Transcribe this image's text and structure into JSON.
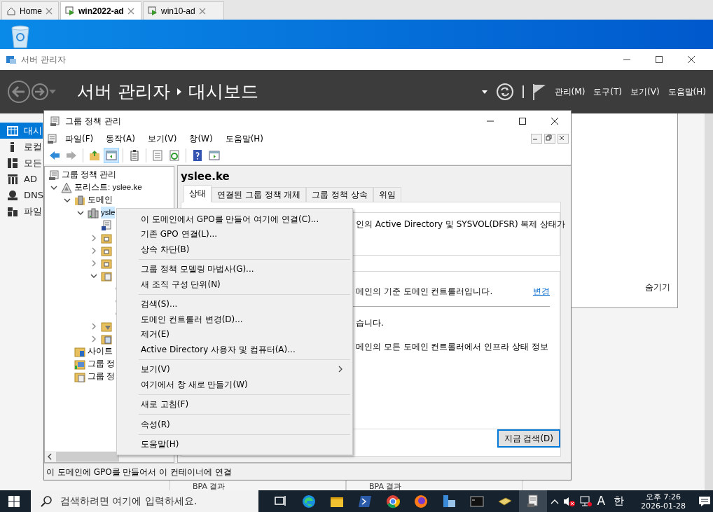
{
  "browser_tabs": [
    {
      "label": "Home",
      "kind": "home",
      "selected": false
    },
    {
      "label": "win2022-ad",
      "kind": "vm",
      "selected": true
    },
    {
      "label": "win10-ad",
      "kind": "vm",
      "selected": false
    }
  ],
  "server_manager": {
    "title": "서버 관리자",
    "breadcrumb": [
      "서버 관리자",
      "대시보드"
    ],
    "menu": [
      "관리(M)",
      "도구(T)",
      "보기(V)",
      "도움말(H)"
    ],
    "sidebar": [
      {
        "label": "대시",
        "kind": "dashboard",
        "selected": true
      },
      {
        "label": "로컬",
        "kind": "local",
        "selected": false
      },
      {
        "label": "모든",
        "kind": "all",
        "selected": false
      },
      {
        "label": "AD",
        "kind": "ad",
        "selected": false
      },
      {
        "label": "DNS",
        "kind": "dns",
        "selected": false
      },
      {
        "label": "파일",
        "kind": "file",
        "selected": false
      }
    ],
    "hide_link": "숨기기",
    "bpa": [
      "BPA 결과",
      "BPA 결과"
    ]
  },
  "gpm": {
    "title": "그룹 정책 관리",
    "menu": [
      "파일(F)",
      "동작(A)",
      "보기(V)",
      "창(W)",
      "도움말(H)"
    ],
    "toolbar": [
      {
        "kind": "back",
        "pressed": false,
        "disabled": false
      },
      {
        "kind": "forward",
        "pressed": false,
        "disabled": true
      },
      {
        "kind": "sep"
      },
      {
        "kind": "up",
        "pressed": false,
        "disabled": false
      },
      {
        "kind": "tree",
        "pressed": true,
        "disabled": false
      },
      {
        "kind": "sep"
      },
      {
        "kind": "clipboard",
        "pressed": false,
        "disabled": false
      },
      {
        "kind": "sep"
      },
      {
        "kind": "export",
        "pressed": false,
        "disabled": false
      },
      {
        "kind": "refresh",
        "pressed": false,
        "disabled": false
      },
      {
        "kind": "sep"
      },
      {
        "kind": "help",
        "pressed": false,
        "disabled": false
      },
      {
        "kind": "pane",
        "pressed": false,
        "disabled": false
      }
    ],
    "tree": [
      {
        "label": "그룹 정책 관리",
        "kind": "gpm",
        "selected": false,
        "children": [
          {
            "label": "포리스트: yslee.ke",
            "kind": "forest",
            "selected": false,
            "expanded": true,
            "children": [
              {
                "label": "도메인",
                "kind": "domains",
                "selected": false,
                "expanded": true,
                "children": [
                  {
                    "label": "ysle",
                    "kind": "domain",
                    "selected": true,
                    "expanded": true,
                    "children": [
                      {
                        "kind": "gpo-link",
                        "selected": false
                      },
                      {
                        "kind": "ou",
                        "selected": false,
                        "expanded": false
                      },
                      {
                        "kind": "ou",
                        "selected": false,
                        "expanded": false
                      },
                      {
                        "kind": "ou",
                        "selected": false,
                        "expanded": false
                      },
                      {
                        "kind": "gpo-folder",
                        "selected": false,
                        "expanded": true,
                        "children": [
                          {
                            "kind": "leaf",
                            "selected": false
                          },
                          {
                            "kind": "leaf",
                            "selected": false
                          },
                          {
                            "kind": "leaf",
                            "selected": false
                          }
                        ]
                      },
                      {
                        "kind": "wmi",
                        "selected": false,
                        "expanded": false
                      },
                      {
                        "kind": "starter",
                        "selected": false,
                        "expanded": false
                      }
                    ]
                  }
                ]
              },
              {
                "label": "사이트",
                "kind": "sites",
                "selected": false
              },
              {
                "label": "그룹 정",
                "kind": "modeling",
                "selected": false
              },
              {
                "label": "그룹 정",
                "kind": "results",
                "selected": false
              }
            ]
          }
        ]
      }
    ],
    "detail": {
      "title": "yslee.ke",
      "tabs": [
        {
          "label": "상태",
          "selected": true
        },
        {
          "label": "연결된 그룹 정책 개체",
          "selected": false
        },
        {
          "label": "그룹 정책 상속",
          "selected": false
        },
        {
          "label": "위임",
          "selected": false
        }
      ],
      "replication_text": "인의 Active Directory 및 SYSVOL(DFSR) 복제 상태가",
      "baseline_text": "메인의 기준 도메인 컨트롤러입니다.",
      "change_link": "변경",
      "status_texts": [
        "습니다.",
        "메인의 모든 도메인 컨트롤러에서 인프라 상태 정보"
      ],
      "search_button": "지금 검색(D)"
    },
    "status_bar": "이 도메인에 GPO를 만들어서 이 컨테이너에 연결"
  },
  "context_menu": {
    "groups": [
      [
        {
          "label": "이 도메인에서 GPO를 만들어 여기에 연결(C)...",
          "submenu": false
        },
        {
          "label": "기존 GPO 연결(L)...",
          "submenu": false
        },
        {
          "label": "상속 차단(B)",
          "submenu": false
        }
      ],
      [
        {
          "label": "그룹 정책 모델링 마법사(G)...",
          "submenu": false
        },
        {
          "label": "새 조직 구성 단위(N)",
          "submenu": false
        }
      ],
      [
        {
          "label": "검색(S)...",
          "submenu": false
        },
        {
          "label": "도메인 컨트롤러 변경(D)...",
          "submenu": false
        },
        {
          "label": "제거(E)",
          "submenu": false
        },
        {
          "label": "Active Directory 사용자 및 컴퓨터(A)...",
          "submenu": false
        }
      ],
      [
        {
          "label": "보기(V)",
          "submenu": true
        },
        {
          "label": "여기에서 창 새로 만들기(W)",
          "submenu": false
        }
      ],
      [
        {
          "label": "새로 고침(F)",
          "submenu": false
        }
      ],
      [
        {
          "label": "속성(R)",
          "submenu": false
        }
      ],
      [
        {
          "label": "도움말(H)",
          "submenu": false
        }
      ]
    ]
  },
  "taskbar": {
    "search_placeholder": "검색하려면 여기에 입력하세요.",
    "apps": [
      {
        "kind": "taskview",
        "active": false
      },
      {
        "kind": "edge",
        "active": false
      },
      {
        "kind": "explorer",
        "active": false
      },
      {
        "kind": "powershell",
        "active": false
      },
      {
        "kind": "chrome",
        "active": false
      },
      {
        "kind": "firefox",
        "active": false
      },
      {
        "kind": "servermanager",
        "active": false
      },
      {
        "kind": "cmd",
        "active": false
      },
      {
        "kind": "adtool",
        "active": false
      },
      {
        "kind": "gpm",
        "active": true
      }
    ],
    "ime": "A",
    "hangul": "한",
    "time": "오후 7:26",
    "date": "2026-01-28"
  }
}
